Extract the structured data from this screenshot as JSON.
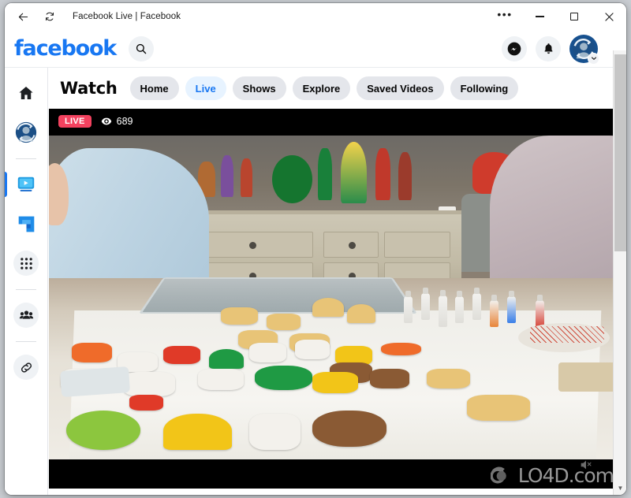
{
  "window": {
    "title": "Facebook Live | Facebook",
    "back_icon": "back-arrow-icon",
    "refresh_icon": "refresh-icon",
    "more_label": "•••",
    "minimize_label": "Minimize",
    "maximize_label": "Maximize",
    "close_label": "✕"
  },
  "header": {
    "logo": "facebook",
    "search_icon": "search-icon",
    "messenger_icon": "messenger-icon",
    "notifications_icon": "bell-icon",
    "avatar_icon": "user-avatar",
    "avatar_badge_icon": "chevron-down-icon"
  },
  "sidebar": {
    "items": [
      {
        "name": "home",
        "icon": "home-icon",
        "label": "Home"
      },
      {
        "name": "profile",
        "icon": "profile-avatar-icon",
        "label": "Profile"
      },
      {
        "name": "watch",
        "icon": "watch-video-icon",
        "label": "Watch",
        "active": true
      },
      {
        "name": "marketplace",
        "icon": "marketplace-icon",
        "label": "Marketplace"
      },
      {
        "name": "menu",
        "icon": "grid-dots-icon",
        "label": "Menu"
      },
      {
        "name": "groups",
        "icon": "groups-people-icon",
        "label": "Groups"
      },
      {
        "name": "link",
        "icon": "link-chain-icon",
        "label": "Link"
      }
    ]
  },
  "watch": {
    "title": "Watch",
    "tabs": [
      {
        "label": "Home",
        "active": false
      },
      {
        "label": "Live",
        "active": true
      },
      {
        "label": "Shows",
        "active": false
      },
      {
        "label": "Explore",
        "active": false
      },
      {
        "label": "Saved Videos",
        "active": false
      },
      {
        "label": "Following",
        "active": false
      }
    ]
  },
  "video": {
    "live_label": "LIVE",
    "viewer_count": "689",
    "eye_icon": "eye-icon",
    "mute_icon": "muted-speaker-icon",
    "watermark_text": "LO4D.com",
    "watermark_logo_icon": "lo4d-logo-icon",
    "scene_description": "Christmas cookie decorating live stream"
  },
  "scrollbar": {
    "down_arrow": "▼"
  },
  "colors": {
    "facebook_blue": "#1877f2",
    "live_red": "#f3425f",
    "tab_active_bg": "#e7f3ff",
    "tab_bg": "#e4e6eb"
  }
}
